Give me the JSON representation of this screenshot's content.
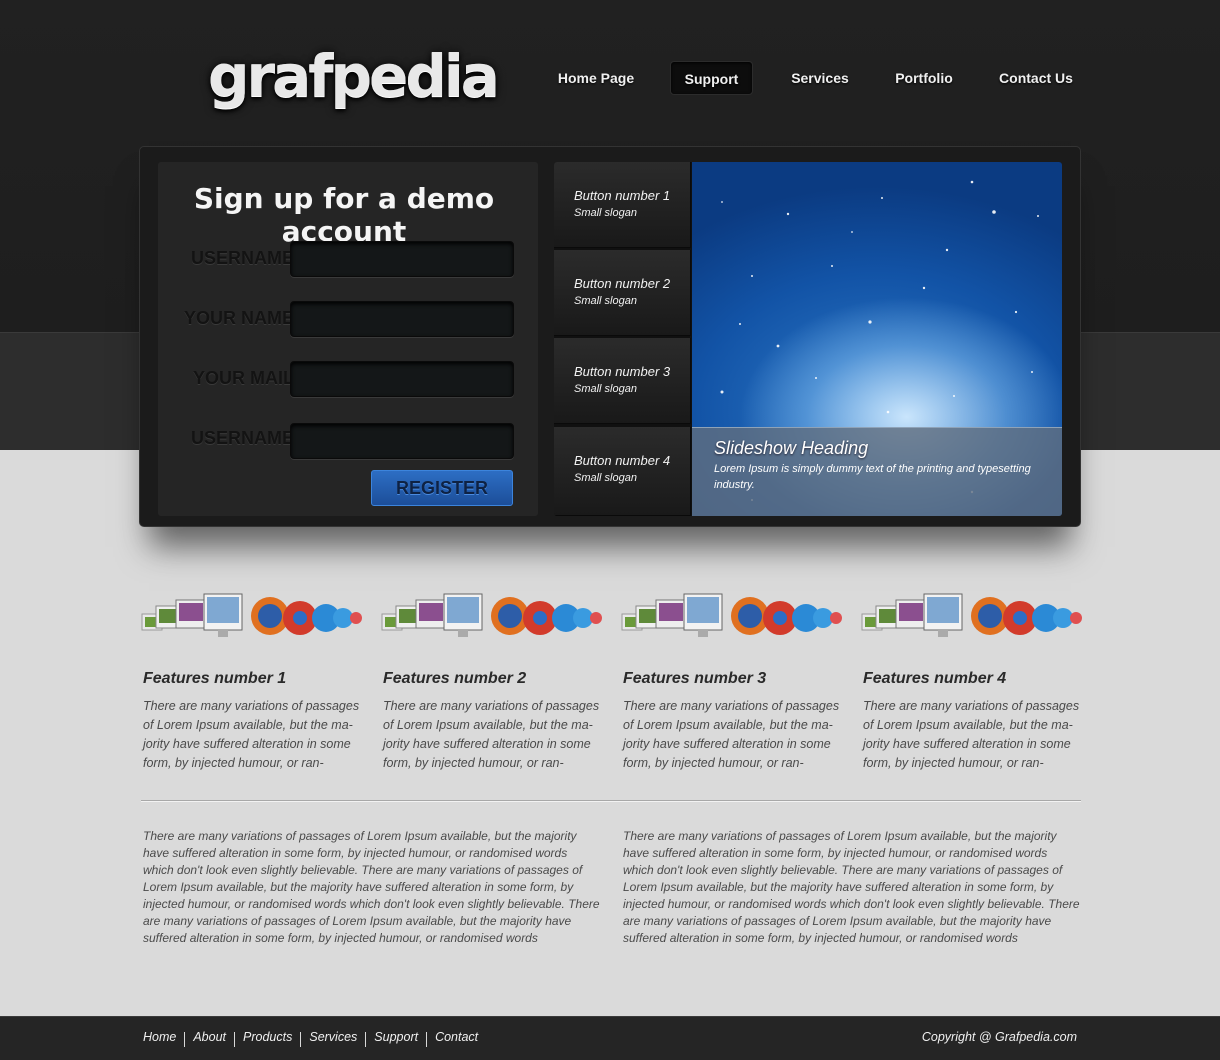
{
  "brand": {
    "logo_text": "grafpedia"
  },
  "nav": {
    "items": [
      {
        "label": "Home Page"
      },
      {
        "label": "Support",
        "active": true
      },
      {
        "label": "Services"
      },
      {
        "label": "Portfolio"
      },
      {
        "label": "Contact Us"
      }
    ]
  },
  "signup": {
    "title": "Sign up for a demo account",
    "fields": [
      {
        "label": "USERNAME",
        "value": ""
      },
      {
        "label": "YOUR NAME",
        "value": ""
      },
      {
        "label": "YOUR MAIL",
        "value": ""
      },
      {
        "label": "USERNAME",
        "value": ""
      }
    ],
    "submit_label": "REGISTER",
    "accent": "#2a66b8"
  },
  "slider": {
    "buttons": [
      {
        "title": "Button number 1",
        "slogan": "Small slogan"
      },
      {
        "title": "Button number 2",
        "slogan": "Small slogan"
      },
      {
        "title": "Button number 3",
        "slogan": "Small slogan"
      },
      {
        "title": "Button number 4",
        "slogan": "Small slogan"
      }
    ],
    "heading": "Slideshow Heading",
    "text": "Lorem Ipsum is simply dummy text of the printing and typesetting industry."
  },
  "features": [
    {
      "title": "Features number 1",
      "text": "There are many variations of passages of Lorem Ipsum available, but the ma-jority have suffered alteration in some form, by injected humour, or ran-"
    },
    {
      "title": "Features number 2",
      "text": "There are many variations of passages of Lorem Ipsum available, but the ma-jority have suffered alteration in some form, by injected humour, or ran-"
    },
    {
      "title": "Features number 3",
      "text": "There are many variations of passages of Lorem Ipsum available, but the ma-jority have suffered alteration in some form, by injected humour, or ran-"
    },
    {
      "title": "Features number 4",
      "text": "There are many variations of passages of Lorem Ipsum available, but the ma-jority have suffered alteration in some form, by injected humour, or ran-"
    }
  ],
  "body_paragraphs": [
    "There are many variations of passages of Lorem Ipsum available, but the majority have suffered alteration in some form, by injected humour, or randomised words which don't look even slightly believable. There are many variations of passages of Lorem Ipsum available, but the majority have suffered alteration in some form, by injected humour, or randomised words which don't look even slightly believable. There are many variations of passages of Lorem Ipsum available, but the majority have suffered alteration in some form, by injected humour, or randomised words",
    "There are many variations of passages of Lorem Ipsum available, but the majority have suffered alteration in some form, by injected humour, or randomised words which don't look even slightly believable. There are many variations of passages of Lorem Ipsum available, but the majority have suffered alteration in some form, by injected humour, or randomised words which don't look even slightly believable. There are many variations of passages of Lorem Ipsum available, but the majority have suffered alteration in some form, by injected humour, or randomised words"
  ],
  "footer": {
    "links": [
      {
        "label": "Home"
      },
      {
        "label": "About"
      },
      {
        "label": "Products"
      },
      {
        "label": "Services"
      },
      {
        "label": "Support"
      },
      {
        "label": "Contact"
      }
    ],
    "copyright": "Copyright @ Grafpedia.com"
  },
  "icons": {
    "feature_icons": [
      "monitor-icon",
      "browser-icon"
    ]
  }
}
